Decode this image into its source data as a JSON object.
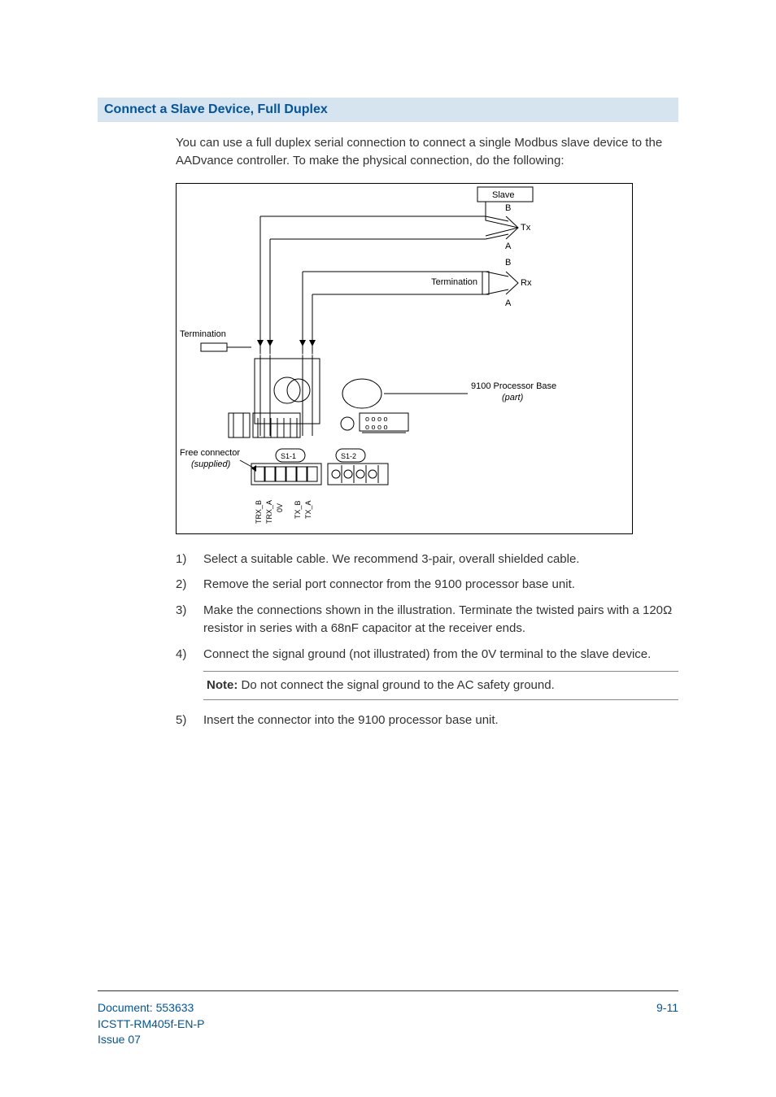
{
  "section_title": "Connect a Slave Device, Full Duplex",
  "intro": "You can use a full duplex serial connection to connect a single Modbus slave device to the AADvance controller. To make the physical connection, do the following:",
  "diagram": {
    "slave_label": "Slave",
    "tx_label": "Tx",
    "rx_label": "Rx",
    "b_label": "B",
    "a_label": "A",
    "termination_label": "Termination",
    "base_label_line1": "9100 Processor Base",
    "base_label_line2": "(part)",
    "free_connector_line1": "Free connector",
    "free_connector_line2": "(supplied)",
    "s1_label": "S1-1",
    "s2_label": "S1-2",
    "pin_labels": [
      "TRX_B",
      "TRX_A",
      "0V",
      "TX_B",
      "TX_A"
    ]
  },
  "steps": [
    "Select a suitable cable. We recommend 3-pair, overall shielded cable.",
    "Remove the serial port connector from the 9100 processor base unit.",
    "Make the connections shown in the illustration. Terminate the twisted pairs with a 120Ω resistor in series with a 68nF capacitor at the receiver ends.",
    "Connect the signal ground (not illustrated) from the 0V terminal to the slave device."
  ],
  "note_bold": "Note:",
  "note_text": " Do not connect the signal ground to the AC safety ground.",
  "step5": "Insert the connector into the 9100 processor base unit.",
  "footer": {
    "doc": "Document: 553633",
    "ref": "ICSTT-RM405f-EN-P",
    "issue": " Issue 07",
    "page": "9-11"
  }
}
